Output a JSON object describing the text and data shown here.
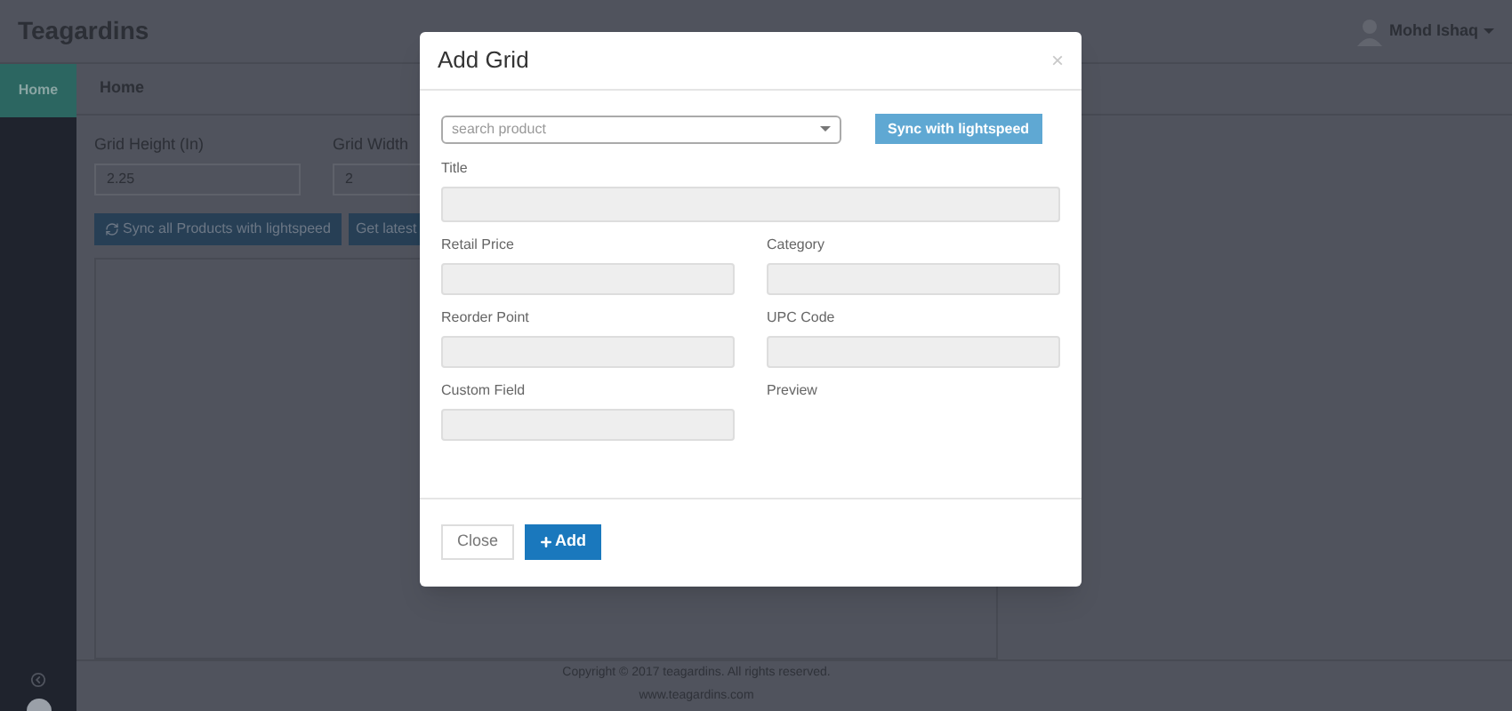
{
  "header": {
    "brand": "Teagardins",
    "user": "Mohd Ishaq"
  },
  "sidebar": {
    "items": [
      {
        "label": "Home",
        "selected": true
      }
    ]
  },
  "breadcrumb": "Home",
  "form": {
    "fields": [
      {
        "label": "Grid Height (In)",
        "value": "2.25"
      },
      {
        "label": "Grid Width",
        "value": "2"
      }
    ],
    "buttons": [
      "Sync all Products with lightspeed",
      "Get latest"
    ]
  },
  "footer": {
    "copyright": "Copyright © 2017 teagardins. All rights reserved.",
    "website": "www.teagardins.com"
  },
  "modal": {
    "title": "Add Grid",
    "close": "×",
    "search": {
      "placeholder": "search product"
    },
    "sync_button": "Sync with lightspeed",
    "fields": [
      {
        "label": "Title",
        "kind": "wide"
      },
      {
        "label": "Retail Price",
        "kind": "input"
      },
      {
        "label": "Category",
        "kind": "input"
      },
      {
        "label": "Reorder Point",
        "kind": "input"
      },
      {
        "label": "UPC Code",
        "kind": "input"
      },
      {
        "label": "Custom Field",
        "kind": "input"
      },
      {
        "label": "Preview",
        "kind": "label"
      }
    ],
    "buttons": [
      {
        "label": "Close",
        "kind": "default"
      },
      {
        "label": "Add",
        "kind": "primary"
      }
    ]
  }
}
